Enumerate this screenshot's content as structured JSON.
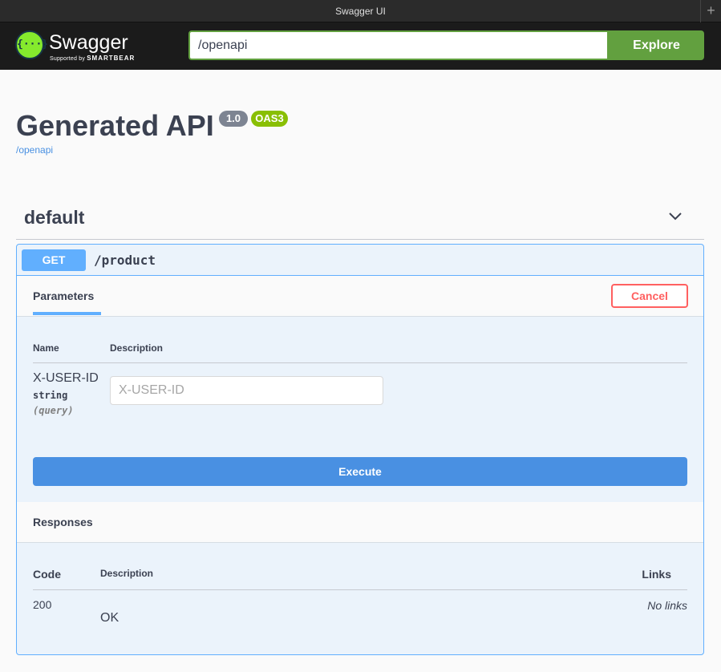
{
  "window": {
    "title": "Swagger UI",
    "new_tab": "+"
  },
  "topbar": {
    "logo_glyph": "{···}",
    "logo_name": "Swagger",
    "logo_sub_prefix": "Supported by",
    "logo_sub_brand": "SMARTBEAR",
    "url_value": "/openapi",
    "explore_label": "Explore",
    "colors": {
      "background": "#1b1b1b",
      "accent": "#62a03f",
      "logo": "#85ea2d"
    }
  },
  "info": {
    "title": "Generated API",
    "version": "1.0",
    "oas_badge": "OAS3",
    "spec_url": "/openapi"
  },
  "tag": {
    "name": "default",
    "chevron_icon": "chevron-down-icon"
  },
  "operation": {
    "method": "GET",
    "path": "/product",
    "method_color": "#61affe",
    "parameters_tab": "Parameters",
    "cancel_label": "Cancel",
    "table_headers": {
      "name": "Name",
      "description": "Description"
    },
    "parameters": [
      {
        "name": "X-USER-ID",
        "type": "string",
        "in": "(query)",
        "placeholder": "X-USER-ID"
      }
    ],
    "execute_label": "Execute",
    "responses_title": "Responses",
    "responses_headers": {
      "code": "Code",
      "description": "Description",
      "links": "Links"
    },
    "responses": [
      {
        "code": "200",
        "description": "OK",
        "links": "No links"
      }
    ]
  }
}
